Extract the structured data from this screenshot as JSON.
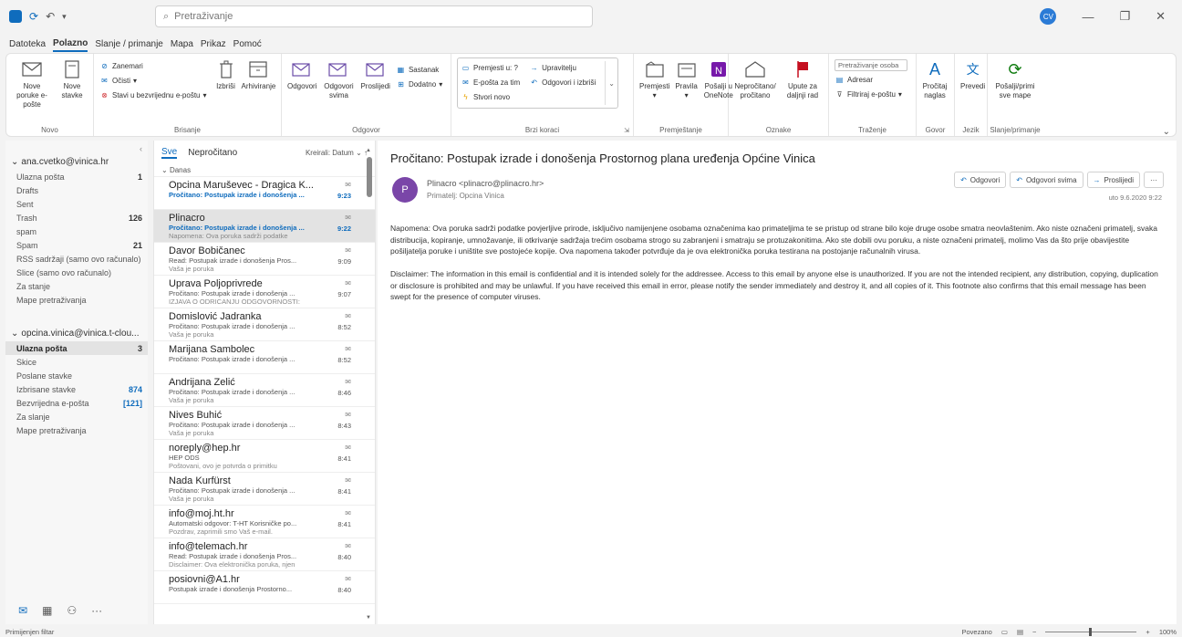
{
  "titlebar": {
    "search_placeholder": "Pretraživanje",
    "avatar_initials": "CV"
  },
  "menu": {
    "tabs": [
      "Datoteka",
      "Polazno",
      "Slanje / primanje",
      "Mapa",
      "Prikaz",
      "Pomoć"
    ]
  },
  "ribbon": {
    "novo": {
      "label": "Novo",
      "new_email": "Nove poruke e-pošte",
      "new_items": "Nove stavke"
    },
    "brisanje": {
      "label": "Brisanje",
      "ignore": "Zanemari",
      "clean": "Očisti",
      "junk": "Stavi u bezvrijednu e-poštu",
      "delete": "Izbriši",
      "archive": "Arhiviranje"
    },
    "odgovor": {
      "label": "Odgovor",
      "reply": "Odgovori",
      "reply_all": "Odgovori svima",
      "forward": "Proslijedi",
      "meeting": "Sastanak",
      "more": "Dodatno"
    },
    "brzi_koraci": {
      "label": "Brzi koraci",
      "move_to": "Premjesti u: ?",
      "team_email": "E-pošta za tim",
      "create_new": "Stvori novo",
      "manager": "Upravitelju",
      "reply_delete": "Odgovori i izbriši"
    },
    "premjestanje": {
      "label": "Premještanje",
      "move": "Premjesti",
      "rules": "Pravila",
      "onenote": "Pošalji u OneNote"
    },
    "oznake": {
      "label": "Oznake",
      "unread_read": "Nepročitano/ pročitano",
      "followup": "Upute za daljnji rad"
    },
    "trazenje": {
      "label": "Traženje",
      "search_people": "Pretraživanje osoba",
      "address_book": "Adresar",
      "filter_email": "Filtriraj e-poštu"
    },
    "govor": {
      "label": "Govor",
      "read_aloud": "Pročitaj naglas"
    },
    "jezik": {
      "label": "Jezik",
      "translate": "Prevedi"
    },
    "slanje": {
      "label": "Slanje/primanje",
      "send_receive_all": "Pošalji/primi sve mape"
    }
  },
  "folders": {
    "account1": "ana.cvetko@vinica.hr",
    "account1_items": [
      {
        "name": "Ulazna pošta",
        "count": "1"
      },
      {
        "name": "Drafts",
        "count": ""
      },
      {
        "name": "Sent",
        "count": ""
      },
      {
        "name": "Trash",
        "count": "126"
      },
      {
        "name": "spam",
        "count": ""
      },
      {
        "name": "Spam",
        "count": "21"
      },
      {
        "name": "RSS sadržaji (samo ovo računalo)",
        "count": ""
      },
      {
        "name": "Slice (samo ovo računalo)",
        "count": ""
      },
      {
        "name": "Za stanje",
        "count": ""
      },
      {
        "name": "Mape pretraživanja",
        "count": ""
      }
    ],
    "account2": "opcina.vinica@vinica.t-clou...",
    "account2_items": [
      {
        "name": "Ulazna pošta",
        "count": "3",
        "selected": true
      },
      {
        "name": "Skice",
        "count": ""
      },
      {
        "name": "Poslane stavke",
        "count": ""
      },
      {
        "name": "Izbrisane stavke",
        "count": "874"
      },
      {
        "name": "Bezvrijedna e-pošta",
        "count": "[121]"
      },
      {
        "name": "Za slanje",
        "count": ""
      },
      {
        "name": "Mape pretraživanja",
        "count": ""
      }
    ]
  },
  "list": {
    "tab_all": "Sve",
    "tab_unread": "Nepročitano",
    "sort": "Kreirali: Datum",
    "group_today": "Danas",
    "messages": [
      {
        "from": "Opcina Marušev​ec - Dragica K...",
        "subject": "Pročitano: Postupak izrade i donošenja ...",
        "preview": "",
        "time": "9:23",
        "blue": true,
        "selected": false
      },
      {
        "from": "Plinacro",
        "subject": "Pročitano: Postupak izrade i donošenja ...",
        "preview": "Napomena: Ova poruka sadrži podatke",
        "time": "9:22",
        "blue": true,
        "selected": true
      },
      {
        "from": "Davor Bobičanec",
        "subject": "Read: Postupak izrade i donošenja Pros...",
        "preview": "Vaša je poruka",
        "time": "9:09",
        "blue": false,
        "selected": false
      },
      {
        "from": "Uprava Poljoprivrede",
        "subject": "Pročitano: Postupak izrade i donošenja ...",
        "preview": "IZJAVA O ODRICANJU ODGOVORNOSTI:",
        "time": "9:07",
        "blue": false,
        "selected": false
      },
      {
        "from": "Domislović Jadranka",
        "subject": "Pročitano: Postupak izrade i donošenja ...",
        "preview": "Vaša je poruka",
        "time": "8:52",
        "blue": false,
        "selected": false
      },
      {
        "from": "Marijana Sambolec",
        "subject": "Pročitano: Postupak izrade i donošenja ...",
        "preview": "",
        "time": "8:52",
        "blue": false,
        "selected": false
      },
      {
        "from": "Andrijana Zelić",
        "subject": "Pročitano: Postupak izrade i donošenja ...",
        "preview": "Vaša je poruka",
        "time": "8:46",
        "blue": false,
        "selected": false
      },
      {
        "from": "Nives Buhić",
        "subject": "Pročitano: Postupak izrade i donošenja ...",
        "preview": "Vaša je poruka",
        "time": "8:43",
        "blue": false,
        "selected": false
      },
      {
        "from": "noreply@hep.hr",
        "subject": "HEP ODS",
        "preview": "Poštovani, ovo je potvrda o primitku",
        "time": "8:41",
        "blue": false,
        "selected": false
      },
      {
        "from": "Nada Kurfürst",
        "subject": "Pročitano: Postupak izrade i donošenja ...",
        "preview": "Vaša je poruka",
        "time": "8:41",
        "blue": false,
        "selected": false
      },
      {
        "from": "info@moj.ht.hr",
        "subject": "Automatski odgovor: T-HT Korisničke po...",
        "preview": "Pozdrav, zaprimili smo Vaš e-mail.",
        "time": "8:41",
        "blue": false,
        "selected": false
      },
      {
        "from": "info@telemach.hr",
        "subject": "Read: Postupak izrade i donošenja Pros...",
        "preview": "Disclaimer: Ova elektronička poruka, njen",
        "time": "8:40",
        "blue": false,
        "selected": false
      },
      {
        "from": "posiovni@A1.hr",
        "subject": "Postupak izrade i donošenja Prostorno...",
        "preview": "",
        "time": "8:40",
        "blue": false,
        "selected": false
      }
    ]
  },
  "reading": {
    "subject": "Pročitano: Postupak izrade i donošenja Prostornog plana uređenja Općine Vinica",
    "avatar": "P",
    "sender": "Plinacro <plinacro@plinacro.hr>",
    "recipient": "Primatelj:  Opcina Vinica",
    "btn_reply": "Odgovori",
    "btn_reply_all": "Odgovori svima",
    "btn_forward": "Proslijedi",
    "btn_more": "···",
    "date": "uto 9.6.2020 9:22",
    "para1": "Napomena: Ova poruka sadrži podatke povjerljive prirode, isključivo namijenjene osobama označenima kao primateljima te se pristup od strane bilo koje druge osobe smatra neovlaštenim. Ako niste označeni primatelj, svaka distribucija, kopiranje, umnožavanje, ili otkrivanje sadržaja trećim osobama strogo su zabranjeni i smatraju se protuzakonitima. Ako ste dobili ovu poruku, a niste označeni primatelj, molimo Vas da što prije obavijestite pošiljatelja poruke i uništite sve postojeće kopije. Ova napomena također potvrđuje da je ova elektronička poruka testirana na postojanje računalnih virusa.",
    "para2": "Disclaimer: The information in this email is confidential and it is intended solely for the addressee. Access to this email by anyone else is unauthorized. If you are not the intended recipient, any distribution, copying, duplication or disclosure is prohibited and may be unlawful. If you have received this email in error, please notify the sender immediately and destroy it, and all copies of it. This footnote also confirms that this email message has been swept for the presence of computer viruses."
  },
  "status": {
    "filter": "Primijenjen filtar",
    "settings": "Povezano",
    "zoom": "100%"
  }
}
